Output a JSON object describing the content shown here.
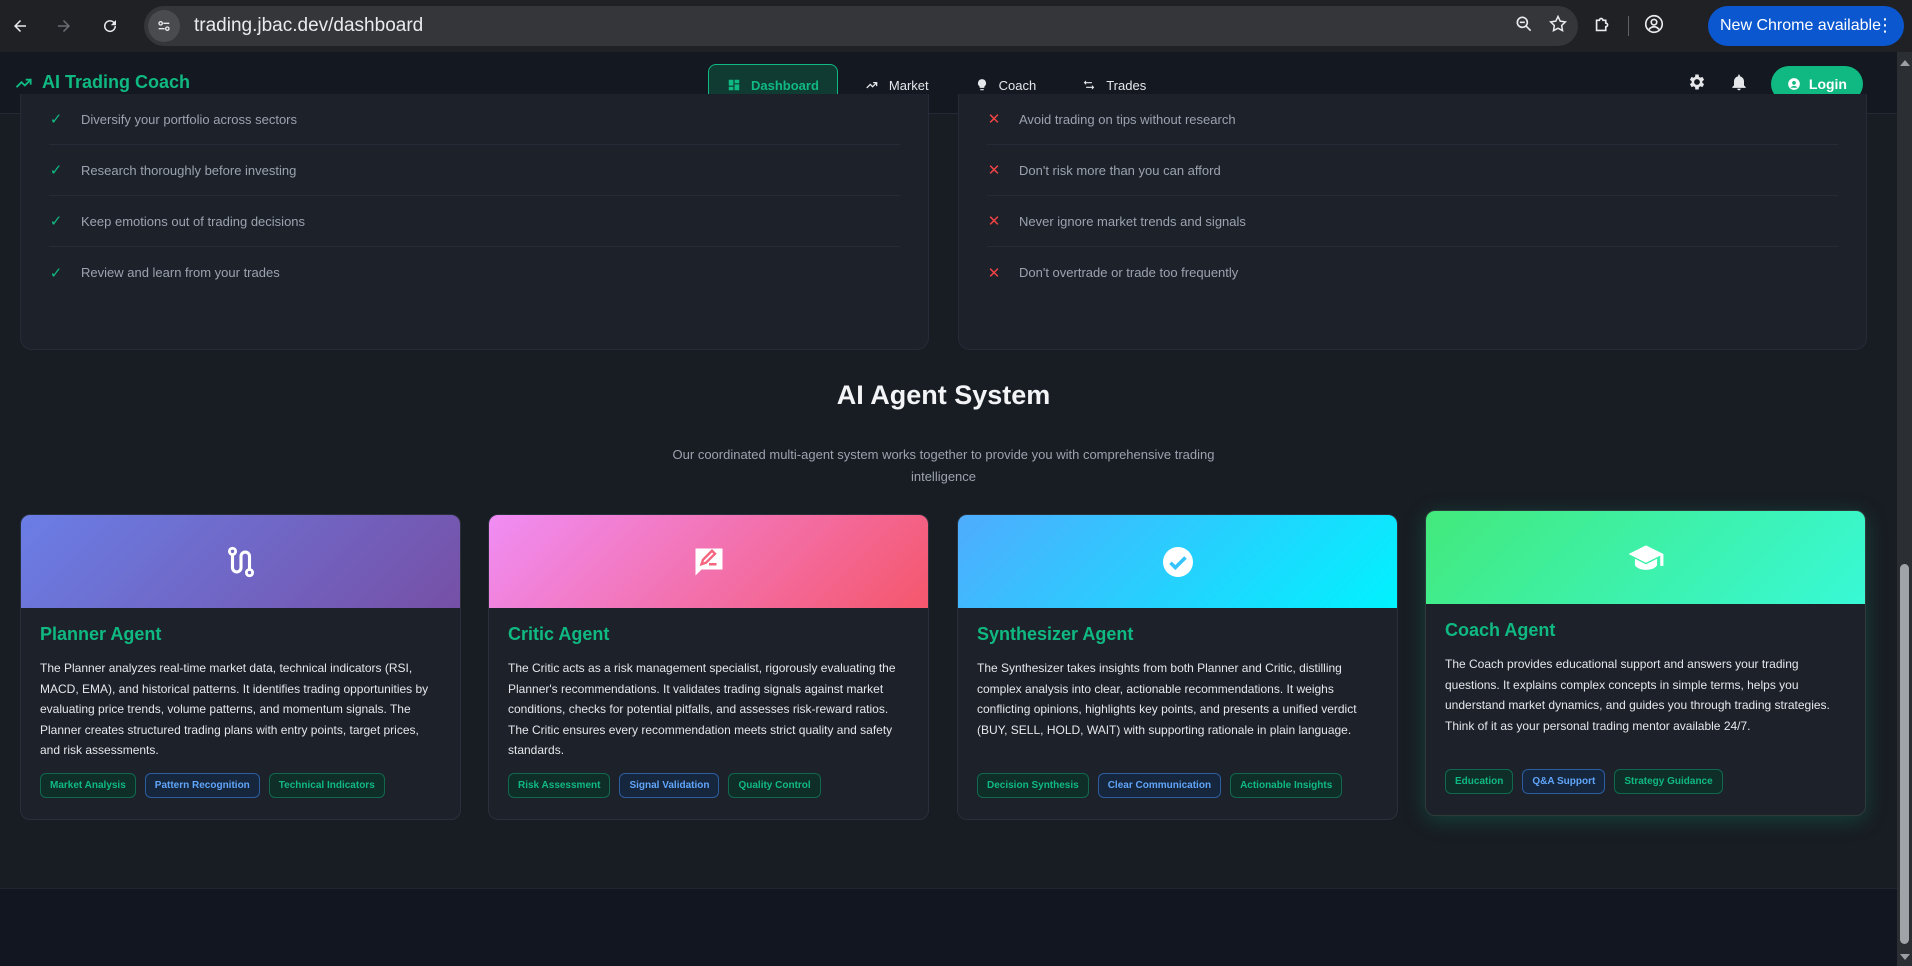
{
  "browser": {
    "url": "trading.jbac.dev/dashboard",
    "update_label": "New Chrome available",
    "icons": [
      "back-arrow-icon",
      "forward-arrow-icon",
      "reload-icon",
      "site-info-icon",
      "zoom-icon",
      "star-icon",
      "extensions-icon",
      "profile-icon",
      "more-vert-icon"
    ]
  },
  "app": {
    "brand": "AI Trading Coach",
    "nav": [
      {
        "label": "Dashboard",
        "icon": "dashboard-icon",
        "active": true
      },
      {
        "label": "Market",
        "icon": "trending-up-icon",
        "active": false
      },
      {
        "label": "Coach",
        "icon": "lightbulb-icon",
        "active": false
      },
      {
        "label": "Trades",
        "icon": "swap-icon",
        "active": false
      }
    ],
    "login_label": "Login"
  },
  "dos": [
    "Diversify your portfolio across sectors",
    "Research thoroughly before investing",
    "Keep emotions out of trading decisions",
    "Review and learn from your trades"
  ],
  "donts": [
    "Avoid trading on tips without research",
    "Don't risk more than you can afford",
    "Never ignore market trends and signals",
    "Don't overtrade or trade too frequently"
  ],
  "agents_section": {
    "title": "AI Agent System",
    "subtitle": "Our coordinated multi-agent system works together to provide you with comprehensive trading intelligence"
  },
  "agents": [
    {
      "name": "Planner Agent",
      "icon": "route-icon",
      "gradient": [
        "#6a7ee6",
        "#7650a6"
      ],
      "description": "The Planner analyzes real-time market data, technical indicators (RSI, MACD, EMA), and historical patterns. It identifies trading opportunities by evaluating price trends, volume patterns, and momentum signals. The Planner creates structured trading plans with entry points, target prices, and risk assessments.",
      "tags": [
        {
          "label": "Market Analysis",
          "color": "green"
        },
        {
          "label": "Pattern Recognition",
          "color": "blue"
        },
        {
          "label": "Technical Indicators",
          "color": "green"
        }
      ]
    },
    {
      "name": "Critic Agent",
      "icon": "rate-review-icon",
      "gradient": [
        "#f08df5",
        "#f5576c"
      ],
      "description": "The Critic acts as a risk management specialist, rigorously evaluating the Planner's recommendations. It validates trading signals against market conditions, checks for potential pitfalls, and assesses risk-reward ratios. The Critic ensures every recommendation meets strict quality and safety standards.",
      "tags": [
        {
          "label": "Risk Assessment",
          "color": "green"
        },
        {
          "label": "Signal Validation",
          "color": "blue"
        },
        {
          "label": "Quality Control",
          "color": "green"
        }
      ]
    },
    {
      "name": "Synthesizer Agent",
      "icon": "check-circle-icon",
      "gradient": [
        "#4facfe",
        "#00f2fe"
      ],
      "description": "The Synthesizer takes insights from both Planner and Critic, distilling complex analysis into clear, actionable recommendations. It weighs conflicting opinions, highlights key points, and presents a unified verdict (BUY, SELL, HOLD, WAIT) with supporting rationale in plain language.",
      "tags": [
        {
          "label": "Decision Synthesis",
          "color": "green"
        },
        {
          "label": "Clear Communication",
          "color": "blue"
        },
        {
          "label": "Actionable Insights",
          "color": "green"
        }
      ]
    },
    {
      "name": "Coach Agent",
      "icon": "graduation-cap-icon",
      "gradient": [
        "#43e97b",
        "#38f9d7"
      ],
      "description": "The Coach provides educational support and answers your trading questions. It explains complex concepts in simple terms, helps you understand market dynamics, and guides you through trading strategies. Think of it as your personal trading mentor available 24/7.",
      "tags": [
        {
          "label": "Education",
          "color": "green"
        },
        {
          "label": "Q&A Support",
          "color": "blue"
        },
        {
          "label": "Strategy Guidance",
          "color": "green"
        }
      ]
    }
  ]
}
